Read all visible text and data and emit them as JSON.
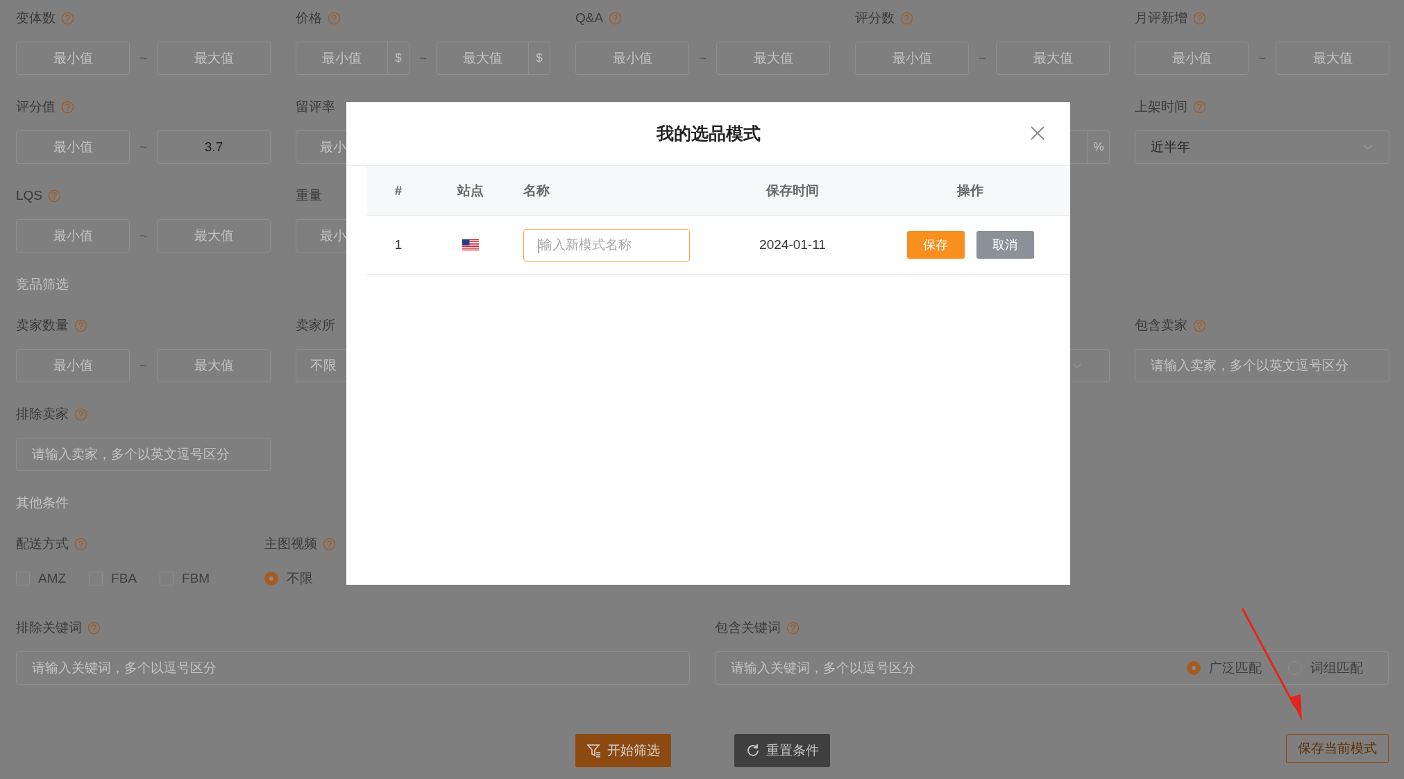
{
  "filter_rows": [
    {
      "cells": [
        {
          "kind": "range",
          "label": "变体数",
          "min_placeholder": "最小值",
          "separator": "~",
          "max_placeholder": "最大值"
        },
        {
          "kind": "range",
          "label": "价格",
          "min_placeholder": "最小值",
          "min_unit": "$",
          "separator": "~",
          "max_placeholder": "最大值",
          "max_unit": "$"
        },
        {
          "kind": "range",
          "label": "Q&A",
          "min_placeholder": "最小值",
          "separator": "~",
          "max_placeholder": "最大值"
        },
        {
          "kind": "range",
          "label": "评分数",
          "min_placeholder": "最小值",
          "separator": "~",
          "max_placeholder": "最大值"
        },
        {
          "kind": "range",
          "label": "月评新增",
          "min_placeholder": "最小值",
          "separator": "~",
          "max_placeholder": "最大值"
        }
      ]
    },
    {
      "cells": [
        {
          "kind": "range",
          "label": "评分值",
          "min_placeholder": "最小值",
          "separator": "~",
          "max_value": "3.7"
        },
        {
          "kind": "range-partial",
          "label": "留评率",
          "text": "最小"
        },
        {
          "kind": "unit-edge",
          "unit": "%"
        },
        {
          "kind": "select",
          "label": "上架时间",
          "value": "近半年"
        }
      ]
    },
    {
      "cells": [
        {
          "kind": "range",
          "label": "LQS",
          "min_placeholder": "最小值",
          "separator": "~",
          "max_placeholder": "最大值"
        },
        {
          "kind": "range-partial",
          "label": "重量",
          "text": "最小"
        }
      ]
    }
  ],
  "competitor_section": {
    "title": "竞品筛选",
    "rows": [
      {
        "cells": [
          {
            "kind": "range",
            "label": "卖家数量",
            "min_placeholder": "最小值",
            "separator": "~",
            "max_placeholder": "最大值"
          },
          {
            "kind": "select-partial",
            "label": "卖家所",
            "text": "不限"
          },
          {
            "kind": "select-edge"
          },
          {
            "kind": "text",
            "label": "包含卖家",
            "placeholder": "请输入卖家，多个以英文逗号区分"
          }
        ]
      },
      {
        "cells": [
          {
            "kind": "text",
            "label": "排除卖家",
            "placeholder": "请输入卖家，多个以英文逗号区分"
          }
        ]
      }
    ]
  },
  "other_section": {
    "title": "其他条件",
    "delivery": {
      "label": "配送方式",
      "options": [
        {
          "label": "AMZ",
          "checked": false
        },
        {
          "label": "FBA",
          "checked": false
        },
        {
          "label": "FBM",
          "checked": false
        }
      ]
    },
    "video": {
      "label": "主图视频",
      "options": [
        {
          "label": "不限",
          "selected": true
        }
      ]
    }
  },
  "keywords": [
    {
      "label": "排除关键词",
      "placeholder": "请输入关键词，多个以逗号区分"
    },
    {
      "label": "包含关键词",
      "placeholder": "请输入关键词，多个以逗号区分",
      "match_options": [
        {
          "label": "广泛匹配",
          "selected": true
        },
        {
          "label": "词组匹配",
          "selected": false
        }
      ]
    }
  ],
  "actions": [
    {
      "label": "开始筛选",
      "kind": "primary"
    },
    {
      "label": "重置条件",
      "kind": "dark"
    },
    {
      "label": "保存当前模式",
      "kind": "outline"
    }
  ],
  "modal": {
    "title": "我的选品模式",
    "columns": [
      "#",
      "站点",
      "名称",
      "保存时间",
      "操作"
    ],
    "rows": [
      {
        "index": "1",
        "name_placeholder": "输入新模式名称",
        "focused": true,
        "saved_time": "2024-01-11",
        "buttons": [
          {
            "label": "保存",
            "kind": "primary"
          },
          {
            "label": "取消",
            "kind": "secondary"
          }
        ]
      }
    ]
  }
}
